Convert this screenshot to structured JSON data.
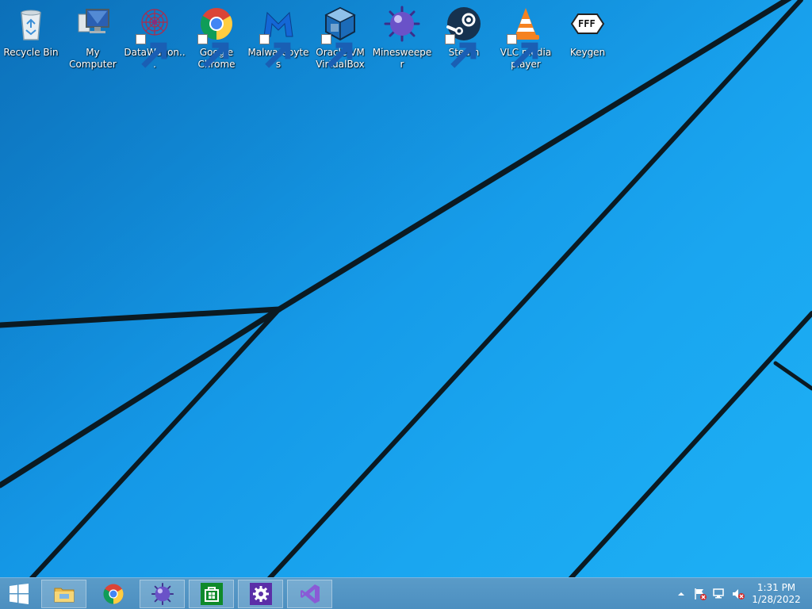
{
  "desktop_icons": [
    {
      "label": "Recycle Bin",
      "icon": "recycle-bin-icon",
      "shortcut": false
    },
    {
      "label": "My Computer",
      "icon": "computer-icon",
      "shortcut": false
    },
    {
      "label": "DataWagon...",
      "icon": "datawagon-icon",
      "shortcut": true
    },
    {
      "label": "Google Chrome",
      "icon": "chrome-icon",
      "shortcut": true
    },
    {
      "label": "Malwarebytes",
      "icon": "malwarebytes-icon",
      "shortcut": true
    },
    {
      "label": "Oracle VM VirtualBox",
      "icon": "virtualbox-icon",
      "shortcut": true
    },
    {
      "label": "Minesweeper",
      "icon": "minesweeper-icon",
      "shortcut": false
    },
    {
      "label": "Steam",
      "icon": "steam-icon",
      "shortcut": true
    },
    {
      "label": "VLC media player",
      "icon": "vlc-icon",
      "shortcut": true
    },
    {
      "label": "Keygen",
      "icon": "keygen-icon",
      "shortcut": false
    }
  ],
  "taskbar": {
    "start_icon": "windows-logo-icon",
    "pinned": [
      "file-explorer-icon",
      "chrome-icon",
      "minesweeper-icon",
      "store-icon",
      "settings-icon",
      "visual-studio-icon"
    ]
  },
  "tray": {
    "icons": [
      "show-hidden-icons-chevron",
      "action-center-flag-icon",
      "network-icon",
      "volume-muted-icon"
    ],
    "time": "1:31 PM",
    "date": "1/28/2022"
  },
  "colors": {
    "wallpaper": "#1aa6f0",
    "taskbar": "#4c8fc0",
    "line": "#0b1a22"
  }
}
